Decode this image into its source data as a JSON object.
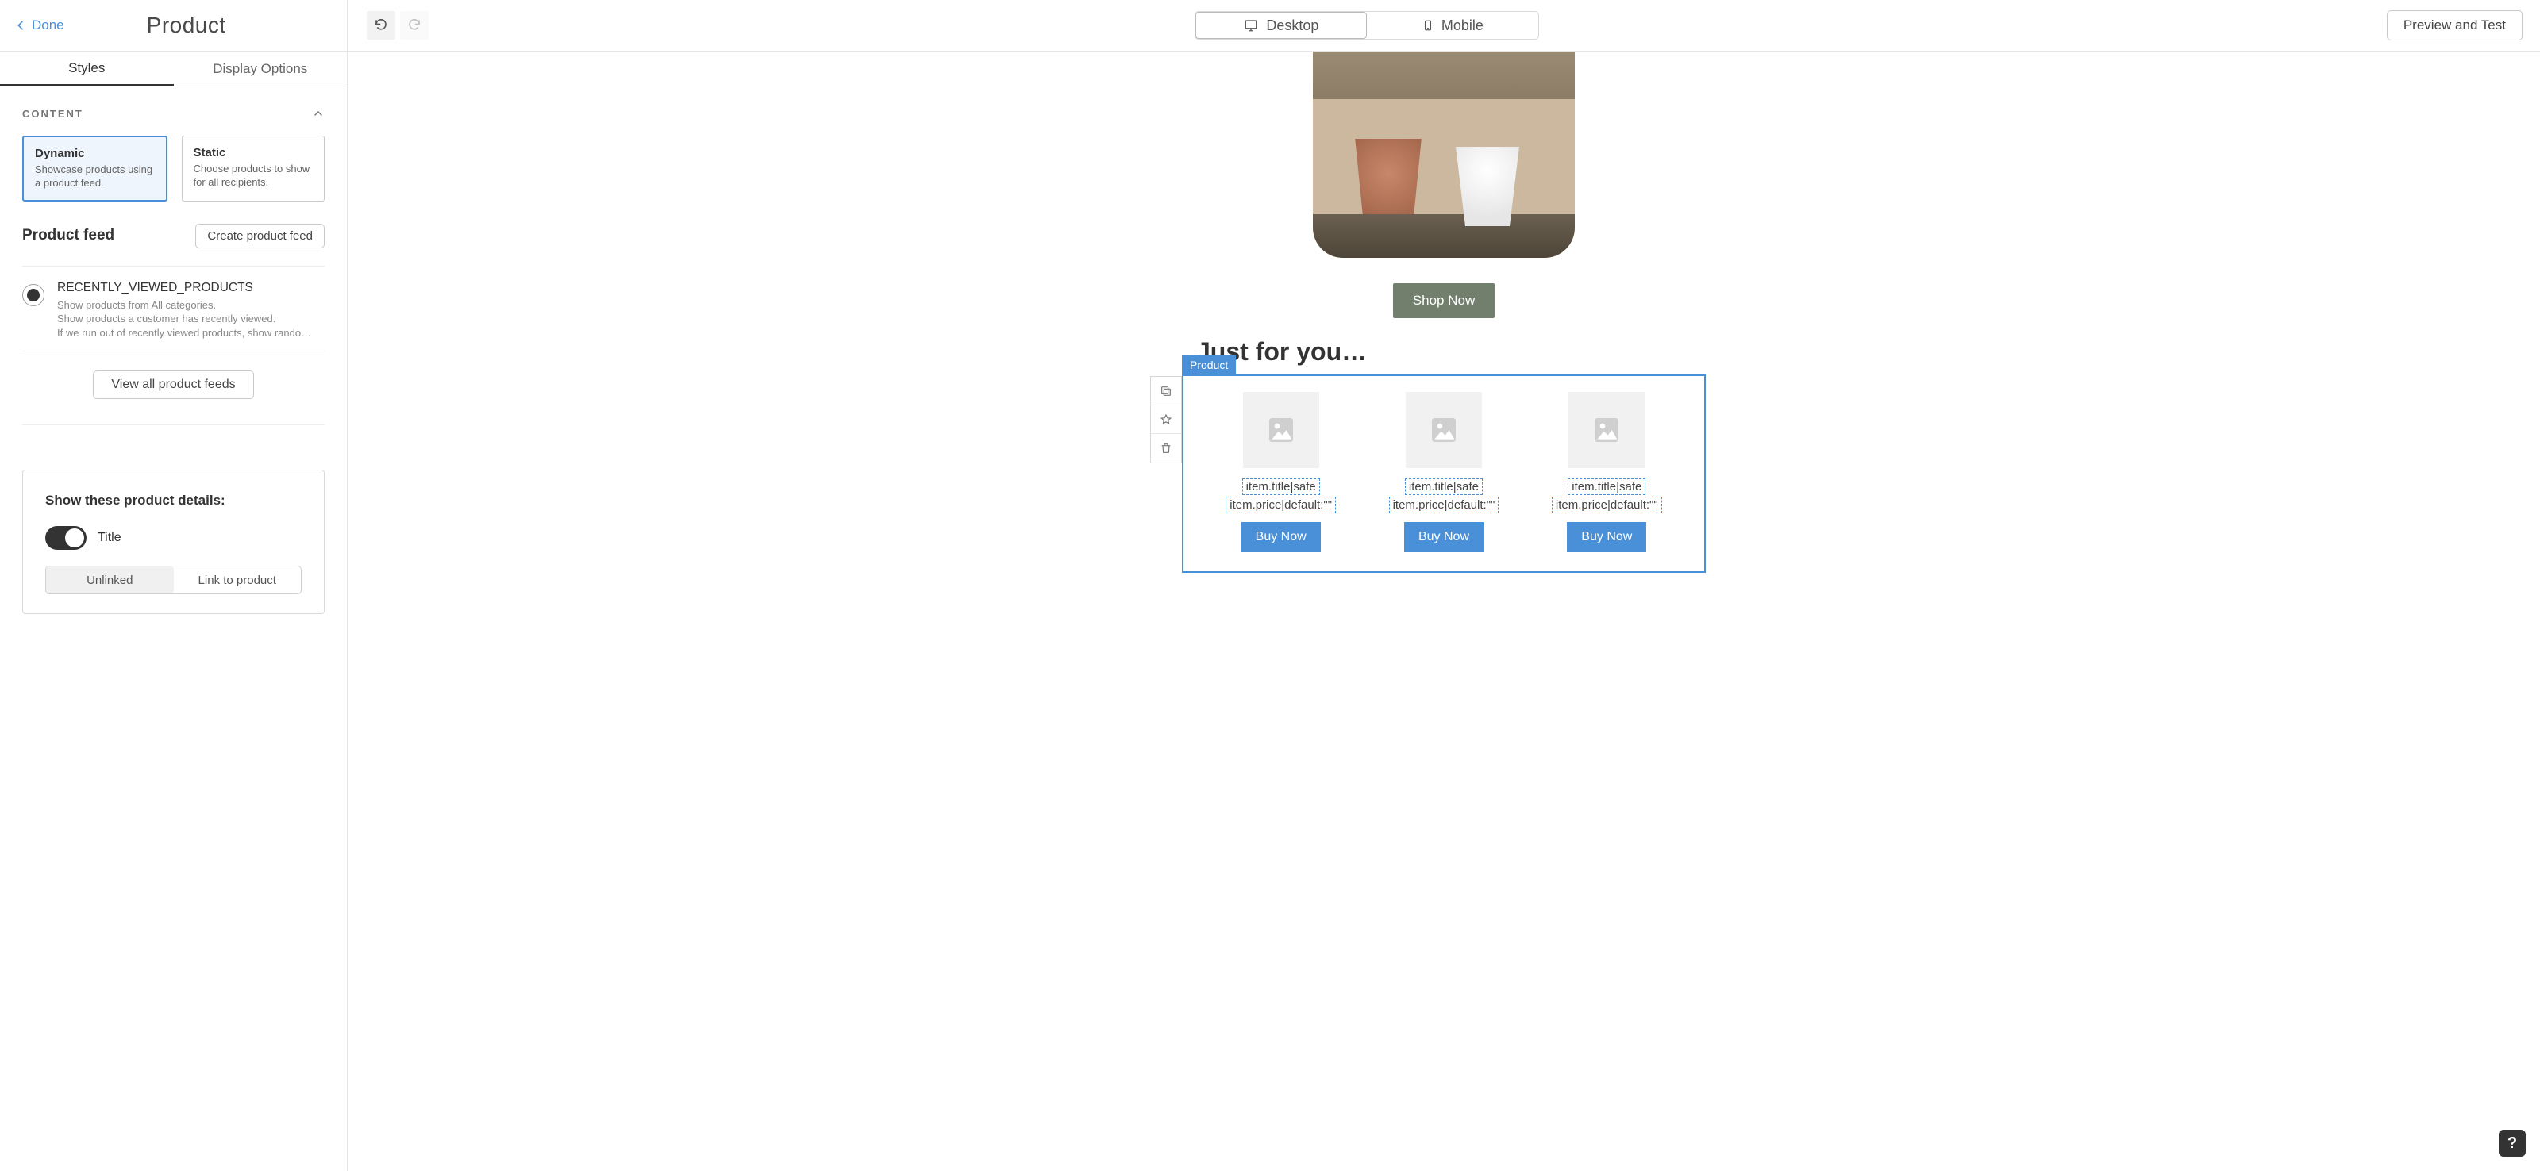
{
  "topbar": {
    "done": "Done",
    "title": "Product",
    "desktop": "Desktop",
    "mobile": "Mobile",
    "preview": "Preview and Test"
  },
  "tabs": {
    "styles": "Styles",
    "display_options": "Display Options"
  },
  "section_content": "CONTENT",
  "modes": {
    "dynamic": {
      "title": "Dynamic",
      "desc": "Showcase products using a product feed."
    },
    "static": {
      "title": "Static",
      "desc": "Choose products to show for all recipients."
    }
  },
  "feed": {
    "label": "Product feed",
    "create_btn": "Create product feed",
    "view_all_btn": "View all product feeds",
    "item": {
      "name": "RECENTLY_VIEWED_PRODUCTS",
      "line1": "Show products from All categories.",
      "line2": "Show products a customer has recently viewed.",
      "line3": "If we run out of recently viewed products, show rando…"
    }
  },
  "details": {
    "heading": "Show these product details:",
    "title_toggle_label": "Title",
    "seg_unlinked": "Unlinked",
    "seg_link": "Link to product"
  },
  "canvas": {
    "shop_btn": "Shop Now",
    "just_for_you": "Just for you…",
    "block_badge": "Product",
    "item_title": "item.title|safe",
    "item_price": "item.price|default:\"\"",
    "buy": "Buy Now"
  },
  "help": "?"
}
